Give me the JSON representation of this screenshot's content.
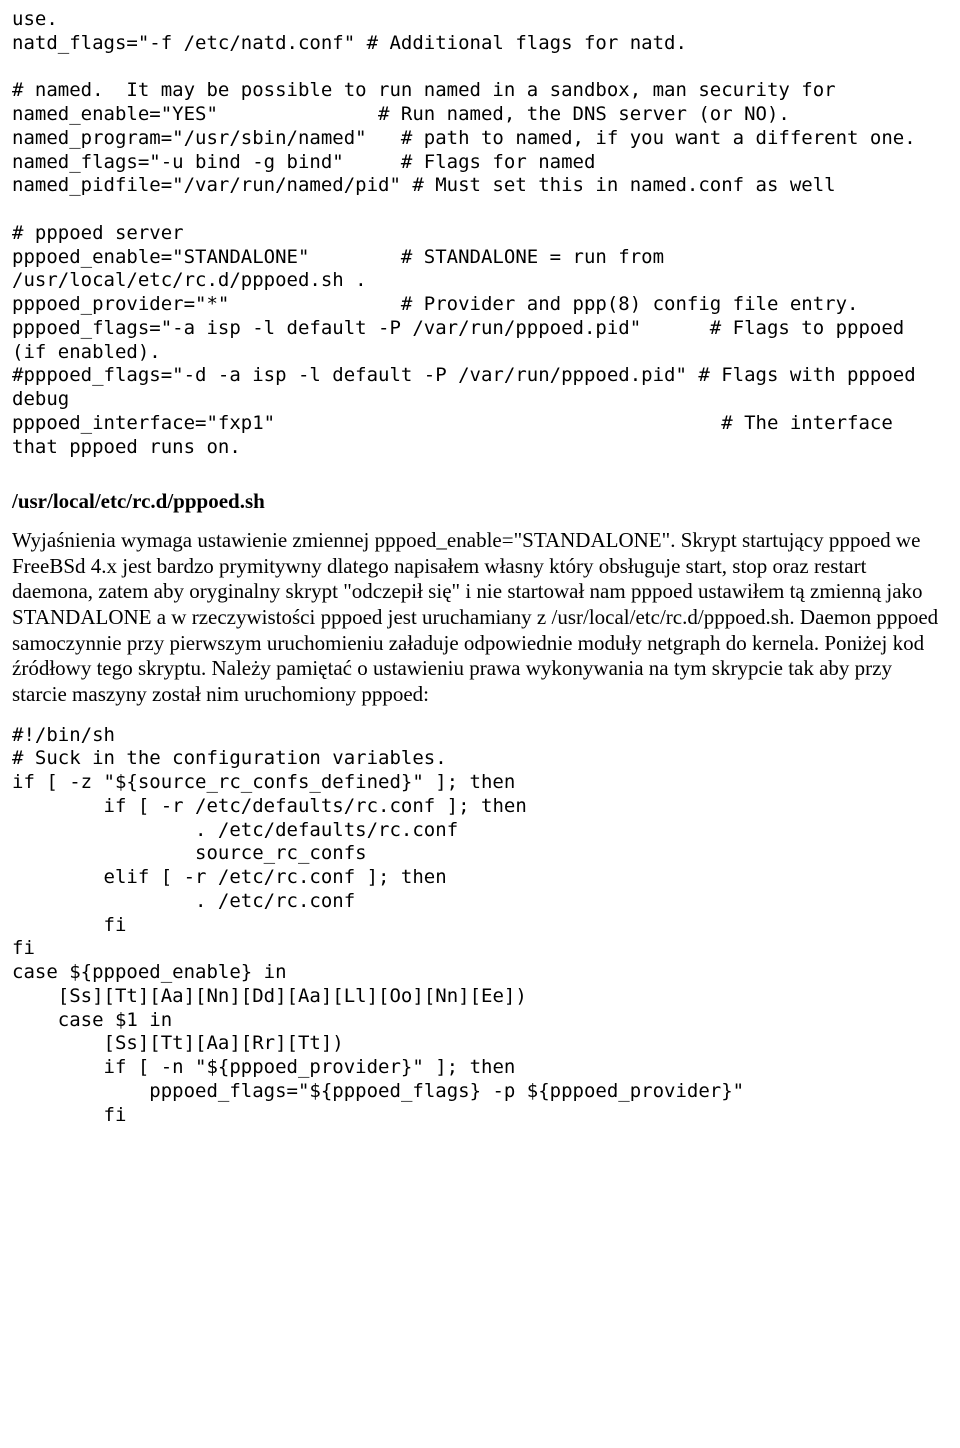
{
  "code_block_1": "use.\nnatd_flags=\"-f /etc/natd.conf\" # Additional flags for natd.\n\n# named.  It may be possible to run named in a sandbox, man security for\nnamed_enable=\"YES\"              # Run named, the DNS server (or NO).\nnamed_program=\"/usr/sbin/named\"   # path to named, if you want a different one.\nnamed_flags=\"-u bind -g bind\"     # Flags for named\nnamed_pidfile=\"/var/run/named/pid\" # Must set this in named.conf as well\n\n# pppoed server\npppoed_enable=\"STANDALONE\"        # STANDALONE = run from /usr/local/etc/rc.d/pppoed.sh .\npppoed_provider=\"*\"               # Provider and ppp(8) config file entry.\npppoed_flags=\"-a isp -l default -P /var/run/pppoed.pid\"      # Flags to pppoed (if enabled).\n#pppoed_flags=\"-d -a isp -l default -P /var/run/pppoed.pid\" # Flags with pppoed debug\npppoed_interface=\"fxp1\"                                       # The interface that pppoed runs on.",
  "heading": "/usr/local/etc/rc.d/pppoed.sh",
  "prose": "Wyjaśnienia wymaga ustawienie zmiennej pppoed_enable=\"STANDALONE\". Skrypt startujący pppoed we FreeBSd 4.x jest bardzo prymitywny dlatego napisałem własny który obsługuje start, stop oraz restart daemona, zatem aby oryginalny skrypt \"odczepił się\" i nie startował nam pppoed ustawiłem tą zmienną jako STANDALONE a w rzeczywistości pppoed jest uruchamiany z /usr/local/etc/rc.d/pppoed.sh. Daemon pppoed samoczynnie przy pierwszym uruchomieniu załaduje odpowiednie moduły netgraph do kernela. Poniżej kod źródłowy tego skryptu. Należy pamiętać o ustawieniu prawa wykonywania na tym skrypcie tak aby przy starcie maszyny został nim uruchomiony pppoed:",
  "code_block_2": "#!/bin/sh\n# Suck in the configuration variables.\nif [ -z \"${source_rc_confs_defined}\" ]; then\n        if [ -r /etc/defaults/rc.conf ]; then\n                . /etc/defaults/rc.conf\n                source_rc_confs\n        elif [ -r /etc/rc.conf ]; then\n                . /etc/rc.conf\n        fi\nfi\ncase ${pppoed_enable} in\n    [Ss][Tt][Aa][Nn][Dd][Aa][Ll][Oo][Nn][Ee])\n    case $1 in\n        [Ss][Tt][Aa][Rr][Tt])\n        if [ -n \"${pppoed_provider}\" ]; then\n            pppoed_flags=\"${pppoed_flags} -p ${pppoed_provider}\"\n        fi"
}
